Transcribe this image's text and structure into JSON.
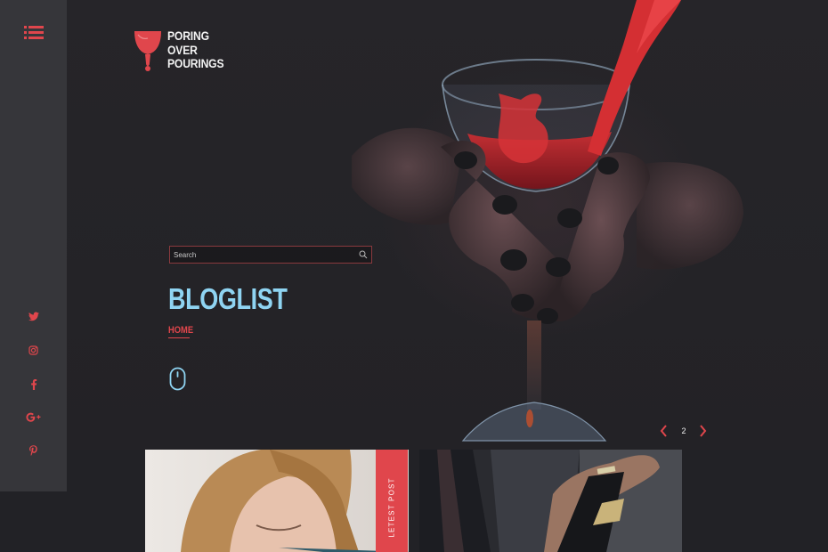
{
  "brand": {
    "line1": "PORING",
    "line2": "OVER",
    "line3": "POURINGS",
    "icon": "wine-drop-glass-logo"
  },
  "sidebar": {
    "menu_icon": "menu-list-icon",
    "social": [
      {
        "name": "twitter",
        "icon": "twitter-icon"
      },
      {
        "name": "instagram",
        "icon": "instagram-icon"
      },
      {
        "name": "facebook",
        "icon": "facebook-icon"
      },
      {
        "name": "google-plus",
        "icon": "google-plus-icon"
      },
      {
        "name": "pinterest",
        "icon": "pinterest-icon"
      }
    ]
  },
  "hero": {
    "search_placeholder": "Search",
    "title": "BLOGLIST",
    "breadcrumb": "HOME",
    "scroll_icon": "mouse-scroll-icon",
    "slide_current": "2"
  },
  "posts": {
    "tag_label": "LETEST POST"
  },
  "colors": {
    "accent": "#e0464c",
    "title": "#8fd4f2",
    "background": "#222226",
    "sidebar": "#36363a"
  }
}
